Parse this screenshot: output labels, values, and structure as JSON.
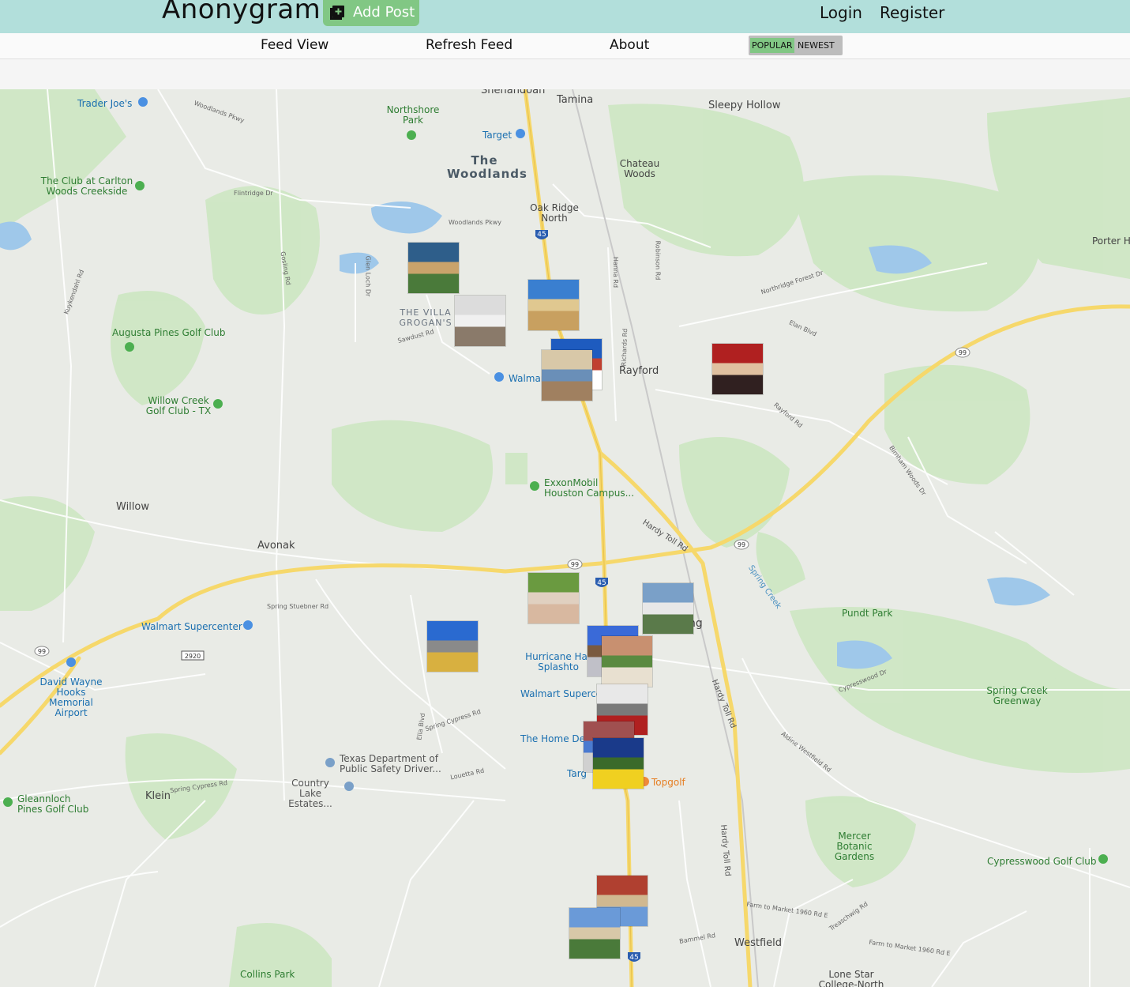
{
  "header": {
    "brand": "Anonygram",
    "add_post_label": "Add Post",
    "login_label": "Login",
    "register_label": "Register",
    "colors": {
      "topbar": "#b2dfdb",
      "add_post": "#81c784"
    }
  },
  "nav": {
    "feed_view": "Feed View",
    "refresh_feed": "Refresh Feed",
    "about": "About",
    "sort_toggle": {
      "popular": "POPULAR",
      "newest": "NEWEST",
      "selected": "POPULAR"
    }
  },
  "map": {
    "labels": {
      "shenandoah": "Shenandoah",
      "tamina": "Tamina",
      "sleepy_hollow": "Sleepy Hollow",
      "trader_joes": "Trader Joe's",
      "northshore_park": "Northshore Park",
      "target_top": "Target",
      "woodlands": "The Woodlands",
      "chateau_woods": "Chateau Woods",
      "club_carlton": "The Club at Carlton Woods Creekside",
      "oak_ridge": "Oak Ridge North",
      "porter": "Porter H",
      "villa_grogans": "THE VILLA GROGAN'S",
      "augusta": "Augusta Pines Golf Club",
      "walmart_top": "Walmar",
      "rayford": "Rayford",
      "willow_creek": "Willow Creek Golf Club - TX",
      "exxon": "ExxonMobil Houston Campus...",
      "willow": "Willow",
      "avonak": "Avonak",
      "hardy_toll": "Hardy Toll Rd",
      "pundt_park": "Pundt Park",
      "walmart_super_left": "Walmart Supercenter",
      "hurricane": "Hurricane Har Splashto",
      "walmart_super_mid": "Walmart Superce",
      "david_wayne": "David Wayne Hooks Memorial Airport",
      "spring_creek_greenway": "Spring Creek Greenway",
      "home_depot": "The Home De",
      "txdps": "Texas Department of Public Safety Driver...",
      "country_lake": "Country Lake Estates...",
      "target_bottom": "Targ",
      "topgolf": "Topgolf",
      "klein": "Klein",
      "gleannloch": "Gleannloch Pines Golf Club",
      "mercer": "Mercer Botanic Gardens",
      "cypresswood_golf": "Cypresswood Golf Club",
      "westfield": "Westfield",
      "collins_park": "Collins Park",
      "lone_star": "Lone Star College-North",
      "spring_partial": "ng"
    },
    "road_labels": {
      "woodlands_pkwy": "Woodlands Pkwy",
      "flintridge": "Flintridge Dr",
      "kuykendahl": "Kuykendahl Rd",
      "gosling": "Gosling Rd",
      "glen_loch": "Glen Loch Dr",
      "hanna": "Hanna Rd",
      "robinson": "Robinson Rd",
      "richards": "Richards Rd",
      "sawdust": "Sawdust Rd",
      "northridge_forest": "Northridge Forest Dr",
      "elan": "Elan Blvd",
      "rayford_rd": "Rayford Rd",
      "birnham_woods": "Birnham Woods Dr",
      "spring_stuebner": "Spring Stuebner Rd",
      "spring_cypress": "Spring Cypress Rd",
      "cypresswood": "Cypresswood Dr",
      "fm1960": "Farm to Market 1960 Rd E",
      "louetta": "Louetta Rd",
      "ella": "Ella Blvd",
      "treaschwig": "Treaschwig Rd",
      "aldine_westfield": "Aldine Westfield Rd",
      "bammel": "Bammel Rd",
      "spring_creek": "Spring Creek",
      "r2920": "2920",
      "i45": "45",
      "r99": "99"
    },
    "posts": [
      {
        "name": "post-apartment-lake",
        "colors": [
          "#2e5e8a",
          "#4a7a3a",
          "#c9a36b"
        ]
      },
      {
        "name": "post-empty-room",
        "colors": [
          "#dcdcdc",
          "#8a7a6a",
          "#f0f0f0"
        ]
      },
      {
        "name": "post-hotel-tower",
        "colors": [
          "#3a7fd0",
          "#c8a060",
          "#e0c890"
        ]
      },
      {
        "name": "post-sign-blue",
        "colors": [
          "#1e5bbf",
          "#ffffff",
          "#c04030"
        ]
      },
      {
        "name": "post-inn-building",
        "colors": [
          "#d8c8a8",
          "#a08060",
          "#6a8fb8"
        ]
      },
      {
        "name": "post-restaurant-people",
        "colors": [
          "#b02020",
          "#302020",
          "#e0c0a0"
        ]
      },
      {
        "name": "post-bulldog-puppy",
        "colors": [
          "#6a9a40",
          "#d8b8a0",
          "#e0d0c0"
        ]
      },
      {
        "name": "post-house-tree",
        "colors": [
          "#7aa0c8",
          "#5a7a4a",
          "#e8e8e8"
        ]
      },
      {
        "name": "post-strip-mall",
        "colors": [
          "#2a6ad0",
          "#d8b040",
          "#8a8a8a"
        ]
      },
      {
        "name": "post-tall-building",
        "colors": [
          "#3a6ad8",
          "#c0c0c8",
          "#7a5a40"
        ]
      },
      {
        "name": "post-hotel-entrance",
        "colors": [
          "#c89070",
          "#e8e0d0",
          "#5a8a40"
        ]
      },
      {
        "name": "post-toyota-dealer",
        "colors": [
          "#e8e8e8",
          "#b02020",
          "#7a7a7a"
        ]
      },
      {
        "name": "post-storefront",
        "colors": [
          "#a05050",
          "#d0d0d0",
          "#4a7ad0"
        ]
      },
      {
        "name": "post-best-buy",
        "colors": [
          "#1a3a8a",
          "#f0d020",
          "#3a6a2a"
        ]
      },
      {
        "name": "post-red-roof-hotel",
        "colors": [
          "#b04030",
          "#6a9ad8",
          "#d0b890"
        ]
      },
      {
        "name": "post-palm-hotel",
        "colors": [
          "#6a9ad8",
          "#4a7a3a",
          "#d8c8a8"
        ]
      }
    ]
  }
}
